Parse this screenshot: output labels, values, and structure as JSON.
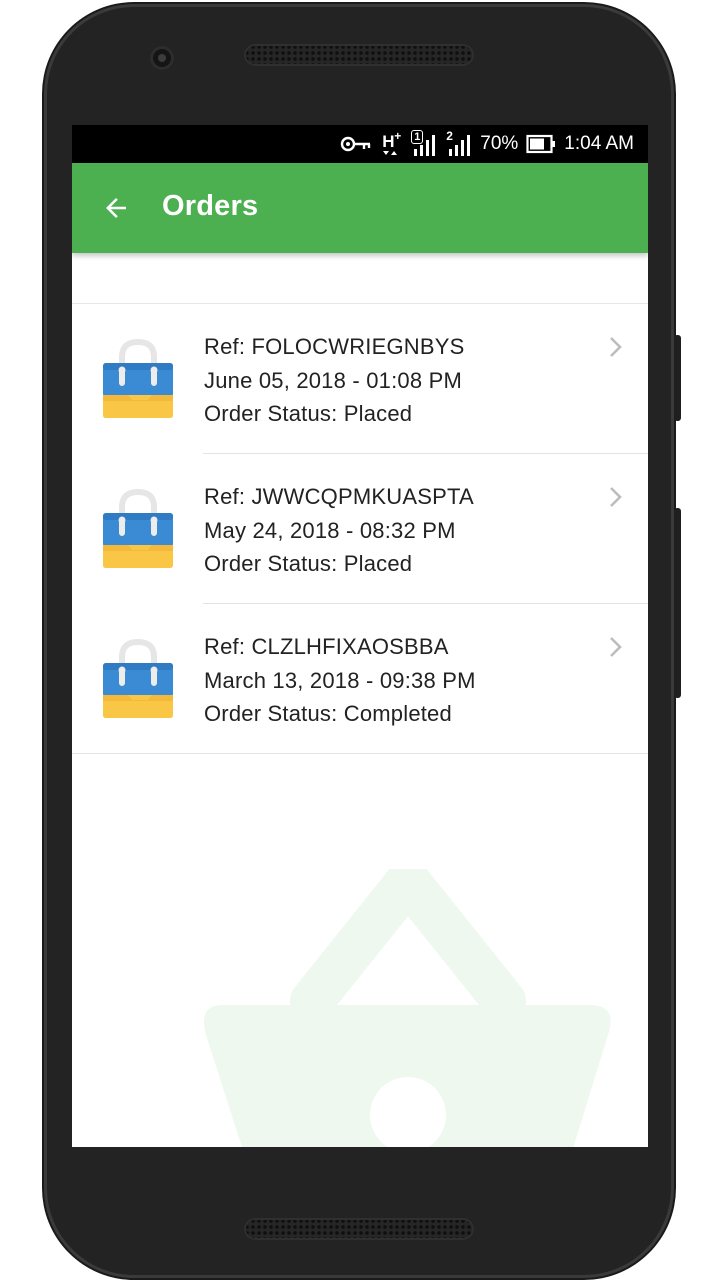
{
  "status_bar": {
    "battery_percent": "70%",
    "time": "1:04 AM",
    "icons": [
      "key-icon",
      "hplus-signal-icon",
      "sim1-signal-icon",
      "sim2-signal-icon",
      "battery-icon"
    ],
    "sim1_label": "1",
    "sim2_label": "2",
    "network_label": "H"
  },
  "app_bar": {
    "title": "Orders",
    "color": "#4caf50",
    "back_icon": "arrow-back-icon"
  },
  "orders": [
    {
      "ref": "Ref: FOLOCWRIEGNBYS",
      "datetime": "June 05, 2018 - 01:08 PM",
      "status": "Order Status: Placed"
    },
    {
      "ref": "Ref: JWWCQPMKUASPTA",
      "datetime": "May 24, 2018 - 08:32 PM",
      "status": "Order Status: Placed"
    },
    {
      "ref": "Ref: CLZLHFIXAOSBBA",
      "datetime": "March 13, 2018 - 09:38 PM",
      "status": "Order Status: Completed"
    }
  ],
  "icons": {
    "order_icon": "shopping-bag-icon",
    "row_chevron": "chevron-right-icon",
    "background": "shopping-basket-icon"
  }
}
